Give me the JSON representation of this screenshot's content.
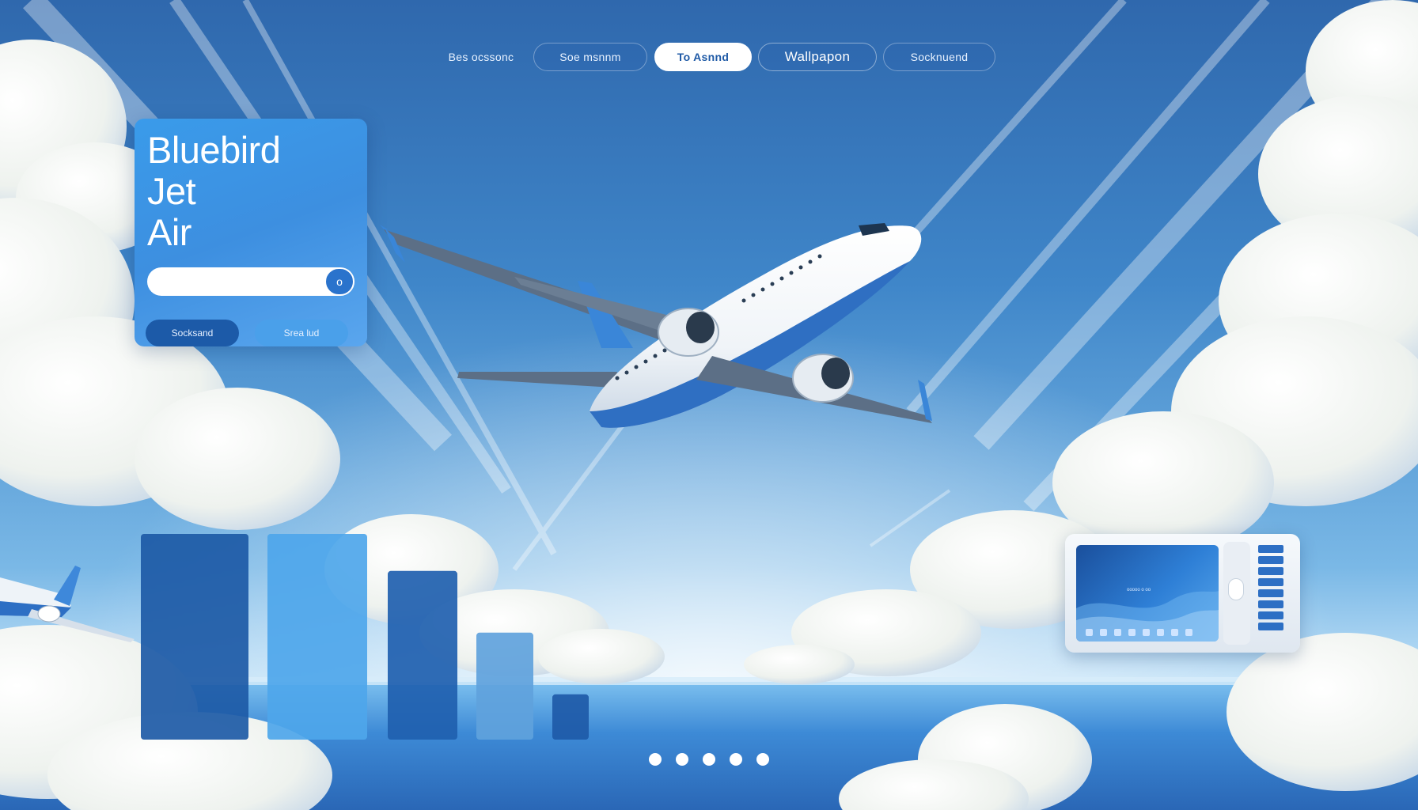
{
  "nav": {
    "items": [
      {
        "label": "Bes ocssonc",
        "state": "plain"
      },
      {
        "label": "Soe msnnm",
        "state": "default"
      },
      {
        "label": "To Asnnd",
        "state": "active"
      },
      {
        "label": "Wallpapon",
        "state": "outlined"
      },
      {
        "label": "Socknuend",
        "state": "default"
      }
    ]
  },
  "brand": {
    "title": "Bluebird\nJet\nAir",
    "search_placeholder": "",
    "search_button_label": "o",
    "buttons": [
      "Socksand",
      "Srea lud"
    ]
  },
  "chart_data": {
    "type": "bar",
    "categories": [
      "",
      "",
      "",
      "",
      ""
    ],
    "values": [
      100,
      100,
      82,
      52,
      22
    ],
    "colors": [
      "#1d5aa6",
      "#4ea6ea",
      "#1f5faf",
      "#5fa2dc",
      "#1e5aa8"
    ],
    "title": "",
    "xlabel": "",
    "ylabel": "",
    "ylim": [
      0,
      100
    ],
    "grid": false
  },
  "device": {
    "screen_text": "ooooo o oo"
  },
  "pagination": {
    "count": 5,
    "active_index": 0
  },
  "colors": {
    "sky_top": "#2f68ad",
    "sky_bottom": "#bfe0f7",
    "accent": "#3a9bea",
    "white": "#ffffff"
  }
}
